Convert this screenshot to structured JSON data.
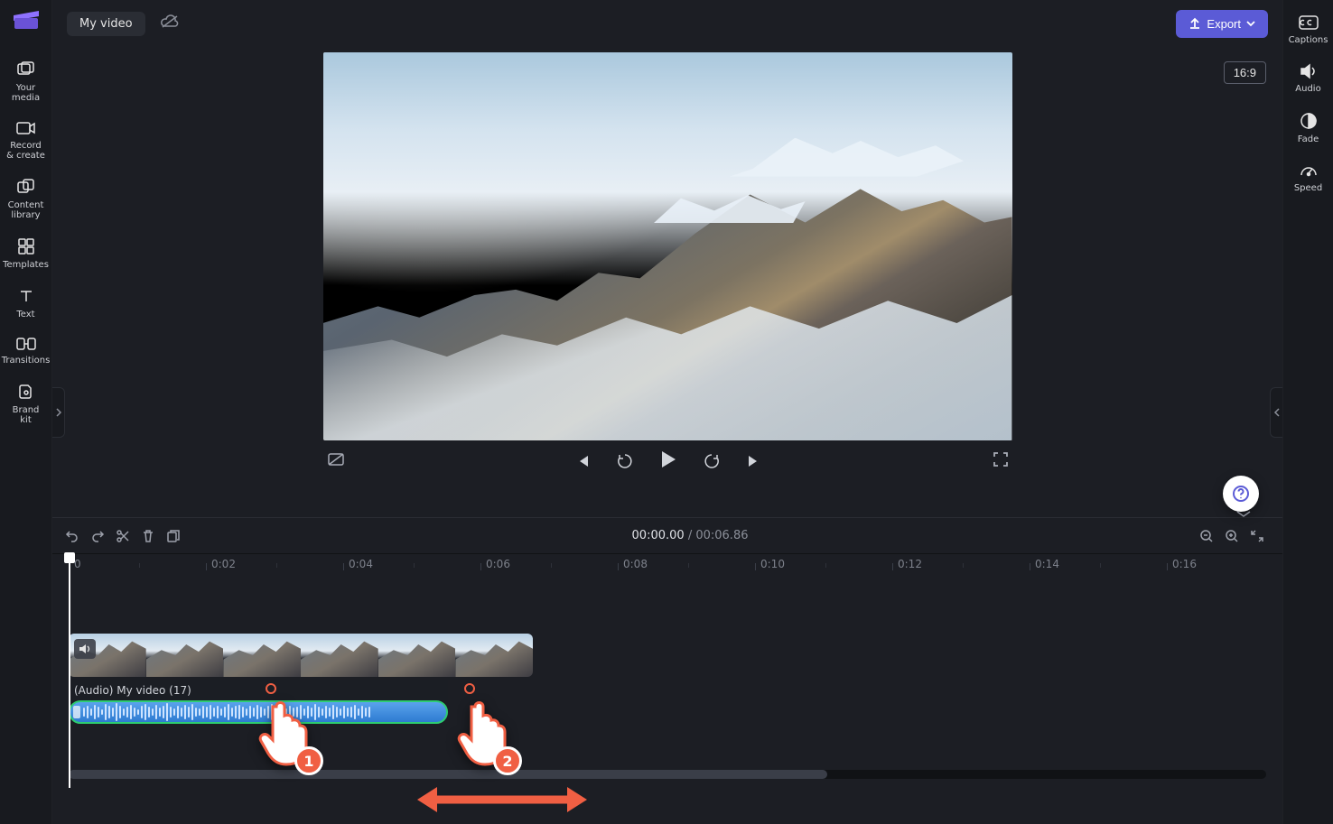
{
  "header": {
    "title": "My video",
    "export_label": "Export"
  },
  "preview": {
    "aspect_ratio_label": "16:9"
  },
  "sidebar_left": {
    "items": [
      {
        "label": "Your media"
      },
      {
        "label": "Record & create"
      },
      {
        "label": "Content library"
      },
      {
        "label": "Templates"
      },
      {
        "label": "Text"
      },
      {
        "label": "Transitions"
      },
      {
        "label": "Brand kit"
      }
    ]
  },
  "sidebar_right": {
    "items": [
      {
        "label": "Captions"
      },
      {
        "label": "Audio"
      },
      {
        "label": "Fade"
      },
      {
        "label": "Speed"
      }
    ]
  },
  "timecode": {
    "current": "00:00.00",
    "separator": "/",
    "duration": "00:06.86"
  },
  "timeline": {
    "ruler_labels": [
      "0",
      "0:02",
      "0:04",
      "0:06",
      "0:08",
      "0:10",
      "0:12",
      "0:14",
      "0:16"
    ],
    "audio_label": "(Audio) My video (17)"
  },
  "tutorial": {
    "step1": "1",
    "step2": "2"
  }
}
